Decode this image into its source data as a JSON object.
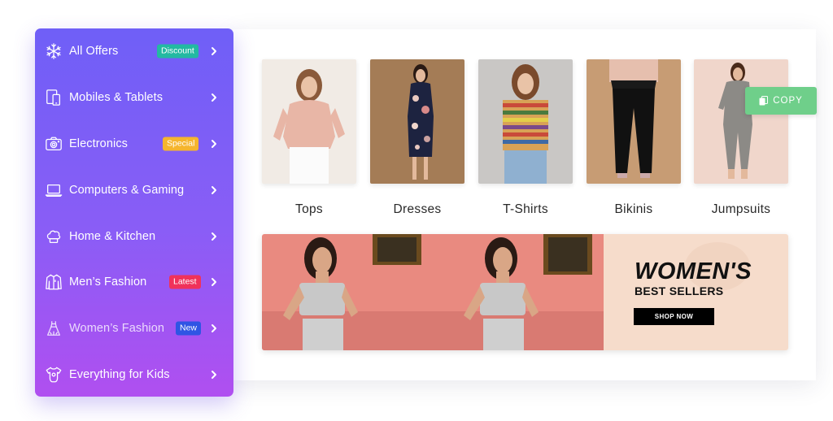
{
  "sidebar": {
    "items": [
      {
        "label": "All Offers",
        "icon": "snowflake-icon",
        "badge": "Discount",
        "badge_color": "#23b9a2"
      },
      {
        "label": "Mobiles & Tablets",
        "icon": "mobile-tablet-icon",
        "badge": "",
        "badge_color": ""
      },
      {
        "label": "Electronics",
        "icon": "camera-icon",
        "badge": "Special",
        "badge_color": "#f5b52e"
      },
      {
        "label": "Computers & Gaming",
        "icon": "laptop-icon",
        "badge": "",
        "badge_color": ""
      },
      {
        "label": "Home & Kitchen",
        "icon": "chef-hat-icon",
        "badge": "",
        "badge_color": ""
      },
      {
        "label": "Men’s Fashion",
        "icon": "jacket-icon",
        "badge": "Latest",
        "badge_color": "#f0325a"
      },
      {
        "label": "Women’s Fashion",
        "icon": "dress-icon",
        "badge": "New",
        "badge_color": "#2f55e4"
      },
      {
        "label": "Everything for Kids",
        "icon": "baby-onesie-icon",
        "badge": "",
        "badge_color": ""
      }
    ]
  },
  "categories": [
    {
      "label": "Tops"
    },
    {
      "label": "Dresses"
    },
    {
      "label": "T-Shirts"
    },
    {
      "label": "Bikinis"
    },
    {
      "label": "Jumpsuits"
    }
  ],
  "copy_button": {
    "label": "COPY",
    "icon": "copy-icon",
    "color": "#6fcf8a"
  },
  "banner": {
    "headline": "WOMEN'S",
    "subhead": "BEST SELLERS",
    "cta": "SHOP NOW"
  },
  "colors": {
    "sidebar_top": "#6f5ff7",
    "sidebar_bottom": "#b04ff0"
  }
}
